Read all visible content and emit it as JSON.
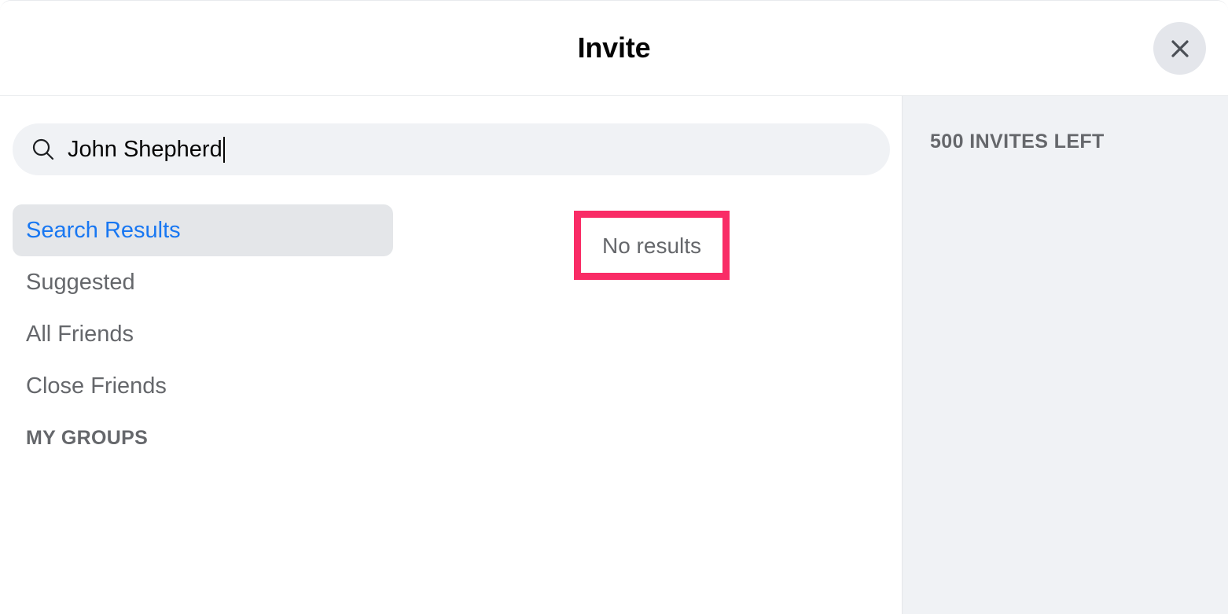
{
  "header": {
    "title": "Invite",
    "close_label": "Close"
  },
  "search": {
    "value": "John Shepherd",
    "placeholder": "Search",
    "icon": "search-icon"
  },
  "nav": {
    "items": [
      {
        "label": "Search Results",
        "selected": true
      },
      {
        "label": "Suggested",
        "selected": false
      },
      {
        "label": "All Friends",
        "selected": false
      },
      {
        "label": "Close Friends",
        "selected": false
      }
    ],
    "section_header": "MY GROUPS"
  },
  "results": {
    "empty_state": "No results"
  },
  "right_panel": {
    "invites_left": "500 INVITES LEFT"
  },
  "colors": {
    "accent_blue": "#1877f2",
    "annotation_pink": "#f92c66",
    "panel_grey": "#f0f2f5",
    "text_secondary": "#65676b",
    "text_primary": "#050505",
    "selected_pill": "#e4e6e9"
  }
}
